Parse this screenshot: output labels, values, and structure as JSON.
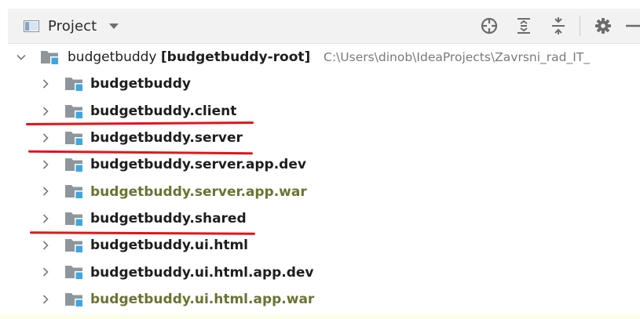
{
  "toolbar": {
    "view_label": "Project",
    "icons": [
      "locate-icon",
      "expand-all-icon",
      "collapse-all-icon",
      "gear-icon",
      "minimize-icon"
    ]
  },
  "tree": {
    "root": {
      "name": "budgetbuddy",
      "module": "[budgetbuddy-root]",
      "path": "C:\\Users\\dinob\\IdeaProjects\\Zavrsni_rad_IT_"
    },
    "items": [
      {
        "label": "budgetbuddy",
        "style": "normal"
      },
      {
        "label": "budgetbuddy.client",
        "style": "normal"
      },
      {
        "label": "budgetbuddy.server",
        "style": "normal"
      },
      {
        "label": "budgetbuddy.server.app.dev",
        "style": "normal"
      },
      {
        "label": "budgetbuddy.server.app.war",
        "style": "excluded"
      },
      {
        "label": "budgetbuddy.shared",
        "style": "normal"
      },
      {
        "label": "budgetbuddy.ui.html",
        "style": "normal"
      },
      {
        "label": "budgetbuddy.ui.html.app.dev",
        "style": "normal"
      },
      {
        "label": "budgetbuddy.ui.html.app.war",
        "style": "excluded"
      }
    ]
  },
  "colors": {
    "underline": "#e3141b",
    "excluded_text": "#6b7331",
    "folder_gray": "#8e969c",
    "module_blue": "#40a6de"
  }
}
